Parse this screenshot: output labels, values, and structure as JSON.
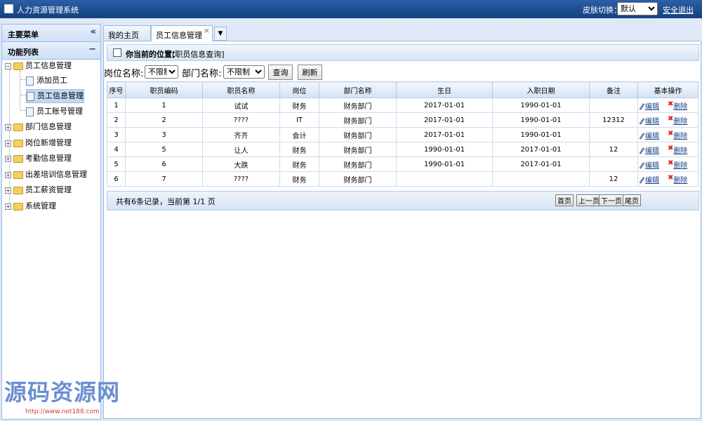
{
  "header": {
    "app_title": "人力资源管理系统",
    "skin_label": "皮肤切换：",
    "skin_value": "默认",
    "logout": "安全退出",
    "colors": {
      "bar": "#1a4a8c",
      "panel_border": "#99bbe8"
    }
  },
  "sidebar": {
    "menu_title": "主要菜单",
    "collapse_symbol": "«",
    "list_title": "功能列表",
    "list_toggle": "−",
    "tree": [
      {
        "label": "员工信息管理",
        "expanded": true,
        "children": [
          "添加员工",
          "员工信息管理",
          "员工账号管理"
        ],
        "selected_child": 1
      },
      {
        "label": "部门信息管理"
      },
      {
        "label": "岗位新增管理"
      },
      {
        "label": "考勤信息管理"
      },
      {
        "label": "出差培训信息管理"
      },
      {
        "label": "员工薪资管理"
      },
      {
        "label": "系统管理"
      }
    ]
  },
  "tabs": [
    {
      "label": "我的主页"
    },
    {
      "label": "员工信息管理",
      "active": true
    }
  ],
  "location": {
    "label": "你当前的位置：",
    "value": "[职员信息查询]"
  },
  "filters": {
    "position_label": "岗位名称:",
    "position_value": "不限制",
    "dept_label": "部门名称:",
    "dept_value": "不限制",
    "query_button": "查询",
    "refresh_button": "刷新"
  },
  "table": {
    "headers": [
      "序号",
      "职员编码",
      "职员名称",
      "岗位",
      "部门名称",
      "生日",
      "入职日期",
      "备注",
      "基本操作"
    ],
    "edit_label": "编辑",
    "delete_label": "删除",
    "rows": [
      [
        "1",
        "1",
        "试试",
        "财务",
        "财务部门",
        "2017-01-01",
        "1990-01-01",
        ""
      ],
      [
        "2",
        "2",
        "????",
        "IT",
        "财务部门",
        "2017-01-01",
        "1990-01-01",
        "12312"
      ],
      [
        "3",
        "3",
        "齐齐",
        "会计",
        "财务部门",
        "2017-01-01",
        "1990-01-01",
        ""
      ],
      [
        "4",
        "5",
        "让人",
        "财务",
        "财务部门",
        "1990-01-01",
        "2017-01-01",
        "12"
      ],
      [
        "5",
        "6",
        "大跌",
        "财务",
        "财务部门",
        "1990-01-01",
        "2017-01-01",
        ""
      ],
      [
        "6",
        "7",
        "????",
        "财务",
        "财务部门",
        "",
        "",
        "12"
      ]
    ]
  },
  "pager": {
    "summary": "共有6条记录，当前第 1/1 页",
    "first": "首页",
    "prev": "上一页",
    "next": "下一页",
    "last": "尾页"
  },
  "watermark": {
    "text": "源码资源网",
    "url": "http://www.net188.com"
  }
}
